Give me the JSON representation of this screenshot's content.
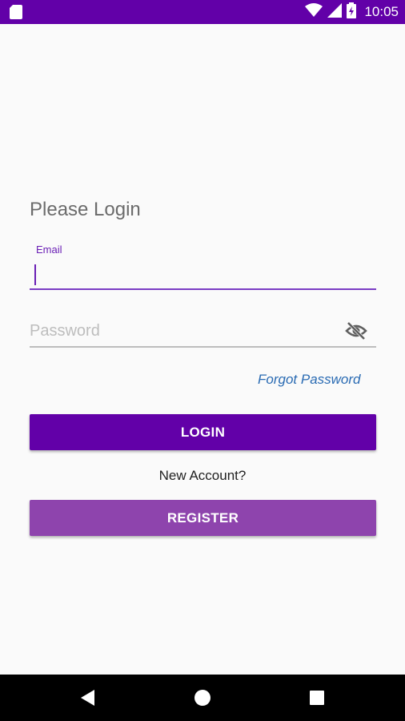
{
  "status_bar": {
    "time": "10:05",
    "icons": [
      "sd-card-icon",
      "wifi-icon",
      "signal-icon",
      "battery-icon"
    ]
  },
  "login_form": {
    "title": "Please Login",
    "email": {
      "label": "Email",
      "value": ""
    },
    "password": {
      "placeholder": "Password",
      "value": ""
    },
    "visibility_icon": "eye-off-icon",
    "forgot_password": "Forgot Password",
    "login_label": "LOGIN",
    "new_account_text": "New Account?",
    "register_label": "REGISTER"
  },
  "nav_bar": {
    "icons": [
      "back-icon",
      "home-icon",
      "recents-icon"
    ]
  },
  "colors": {
    "primary": "#6200a8",
    "secondary": "#8e44ad",
    "link": "#2a6bb3",
    "accent_label": "#6a1fb5"
  }
}
